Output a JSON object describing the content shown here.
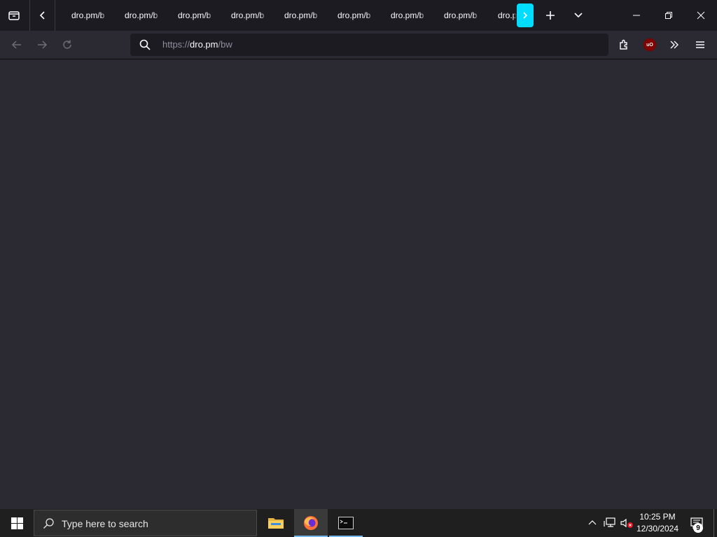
{
  "browser": {
    "tabs": [
      {
        "label": "dro.pm/b"
      },
      {
        "label": "dro.pm/b"
      },
      {
        "label": "dro.pm/b"
      },
      {
        "label": "dro.pm/b"
      },
      {
        "label": "dro.pm/b"
      },
      {
        "label": "dro.pm/b"
      },
      {
        "label": "dro.pm/b"
      },
      {
        "label": "dro.pm/b"
      },
      {
        "label": "dro.pm"
      }
    ],
    "url": {
      "scheme": "https://",
      "host": "dro.pm",
      "path": "/bw"
    },
    "ublock_label": "uO",
    "colors": {
      "accent": "#00ddff",
      "tabstrip_bg": "#1c1b22",
      "toolbar_bg": "#2b2a33"
    }
  },
  "taskbar": {
    "search_placeholder": "Type here to search",
    "clock": {
      "time": "10:25 PM",
      "date": "12/30/2024"
    },
    "notification_count": "9",
    "apps": [
      "file-explorer",
      "firefox",
      "terminal"
    ]
  }
}
